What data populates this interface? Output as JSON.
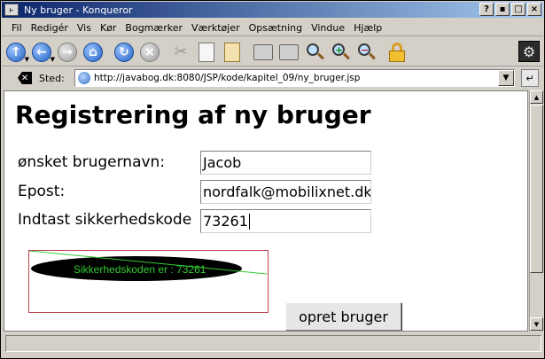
{
  "window": {
    "title": "Ny bruger - Konqueror",
    "buttons": {
      "help": "?",
      "minimize": "▪",
      "maximize": "□",
      "close": "×"
    }
  },
  "menu": [
    {
      "label": "Fil"
    },
    {
      "label": "Redigér"
    },
    {
      "label": "Vis"
    },
    {
      "label": "Kør"
    },
    {
      "label": "Bogmærker"
    },
    {
      "label": "Værktøjer"
    },
    {
      "label": "Opsætning"
    },
    {
      "label": "Vindue"
    },
    {
      "label": "Hjælp"
    }
  ],
  "toolbar": {
    "icons": [
      "up-icon",
      "back-icon",
      "forward-icon",
      "home-icon",
      "reload-icon",
      "stop-icon",
      "cut-icon",
      "copy-icon",
      "paste-icon",
      "print-icon",
      "zoom-icon",
      "zoom-in-icon",
      "zoom-out-icon",
      "lock-icon",
      "konqueror-gear-icon"
    ]
  },
  "location": {
    "label": "Sted:",
    "url": "http://javabog.dk:8080/JSP/kode/kapitel_09/ny_bruger.jsp"
  },
  "page": {
    "title": "Registrering af ny bruger",
    "fields": [
      {
        "label": "ønsket brugernavn:",
        "value": "Jacob"
      },
      {
        "label": "Epost:",
        "value": "nordfalk@mobilixnet.dk"
      },
      {
        "label": "Indtast sikkerhedskode",
        "value": "73261"
      }
    ],
    "captcha_text": "Sikkerhedskoden er : 73261",
    "submit_label": "opret bruger"
  },
  "colors": {
    "titlebar_start": "#0a246a",
    "titlebar_end": "#a6caf0",
    "captcha_text": "#33cc33",
    "captcha_border": "#c04050"
  }
}
